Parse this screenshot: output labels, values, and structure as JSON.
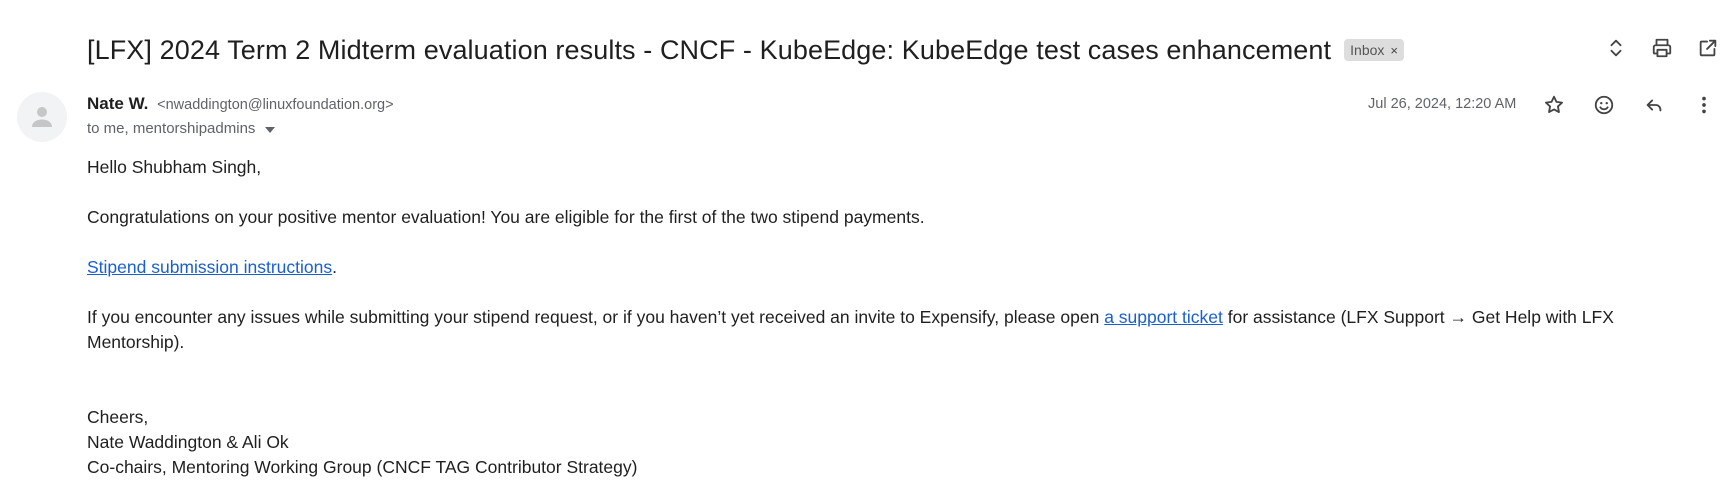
{
  "email": {
    "subject": "[LFX] 2024 Term 2 Midterm evaluation results - CNCF - KubeEdge: KubeEdge test cases enhancement",
    "label": "Inbox",
    "label_remove": "×",
    "sender_name": "Nate W.",
    "sender_email": "<nwaddington@linuxfoundation.org>",
    "recipients": "to me, mentorshipadmins",
    "date": "Jul 26, 2024, 12:20 AM"
  },
  "icons": {
    "expand": "unfold-icon",
    "print": "print-icon",
    "popout": "open-in-new-icon",
    "star": "star-icon",
    "emoji": "emoji-icon",
    "reply": "reply-icon",
    "more": "more-vert-icon"
  },
  "body": {
    "greeting": "Hello Shubham Singh,",
    "para1": "Congratulations on your positive mentor evaluation! You are eligible for the first of the two stipend payments.",
    "link1": "Stipend submission instructions",
    "link1_suffix": ".",
    "para3_before": "If you encounter any issues while submitting your stipend request, or if you haven’t yet received an invite to Expensify, please open ",
    "para3_link": "a support ticket",
    "para3_after": " for assistance (LFX Support → Get Help with LFX Mentorship).",
    "signoff": "Cheers,",
    "signature1": "Nate Waddington & Ali Ok",
    "signature2": "Co-chairs, Mentoring Working Group (CNCF TAG Contributor Strategy)"
  },
  "colors": {
    "link": "#1a5fd0",
    "text": "#1f1f1f",
    "muted": "#5f6368"
  }
}
